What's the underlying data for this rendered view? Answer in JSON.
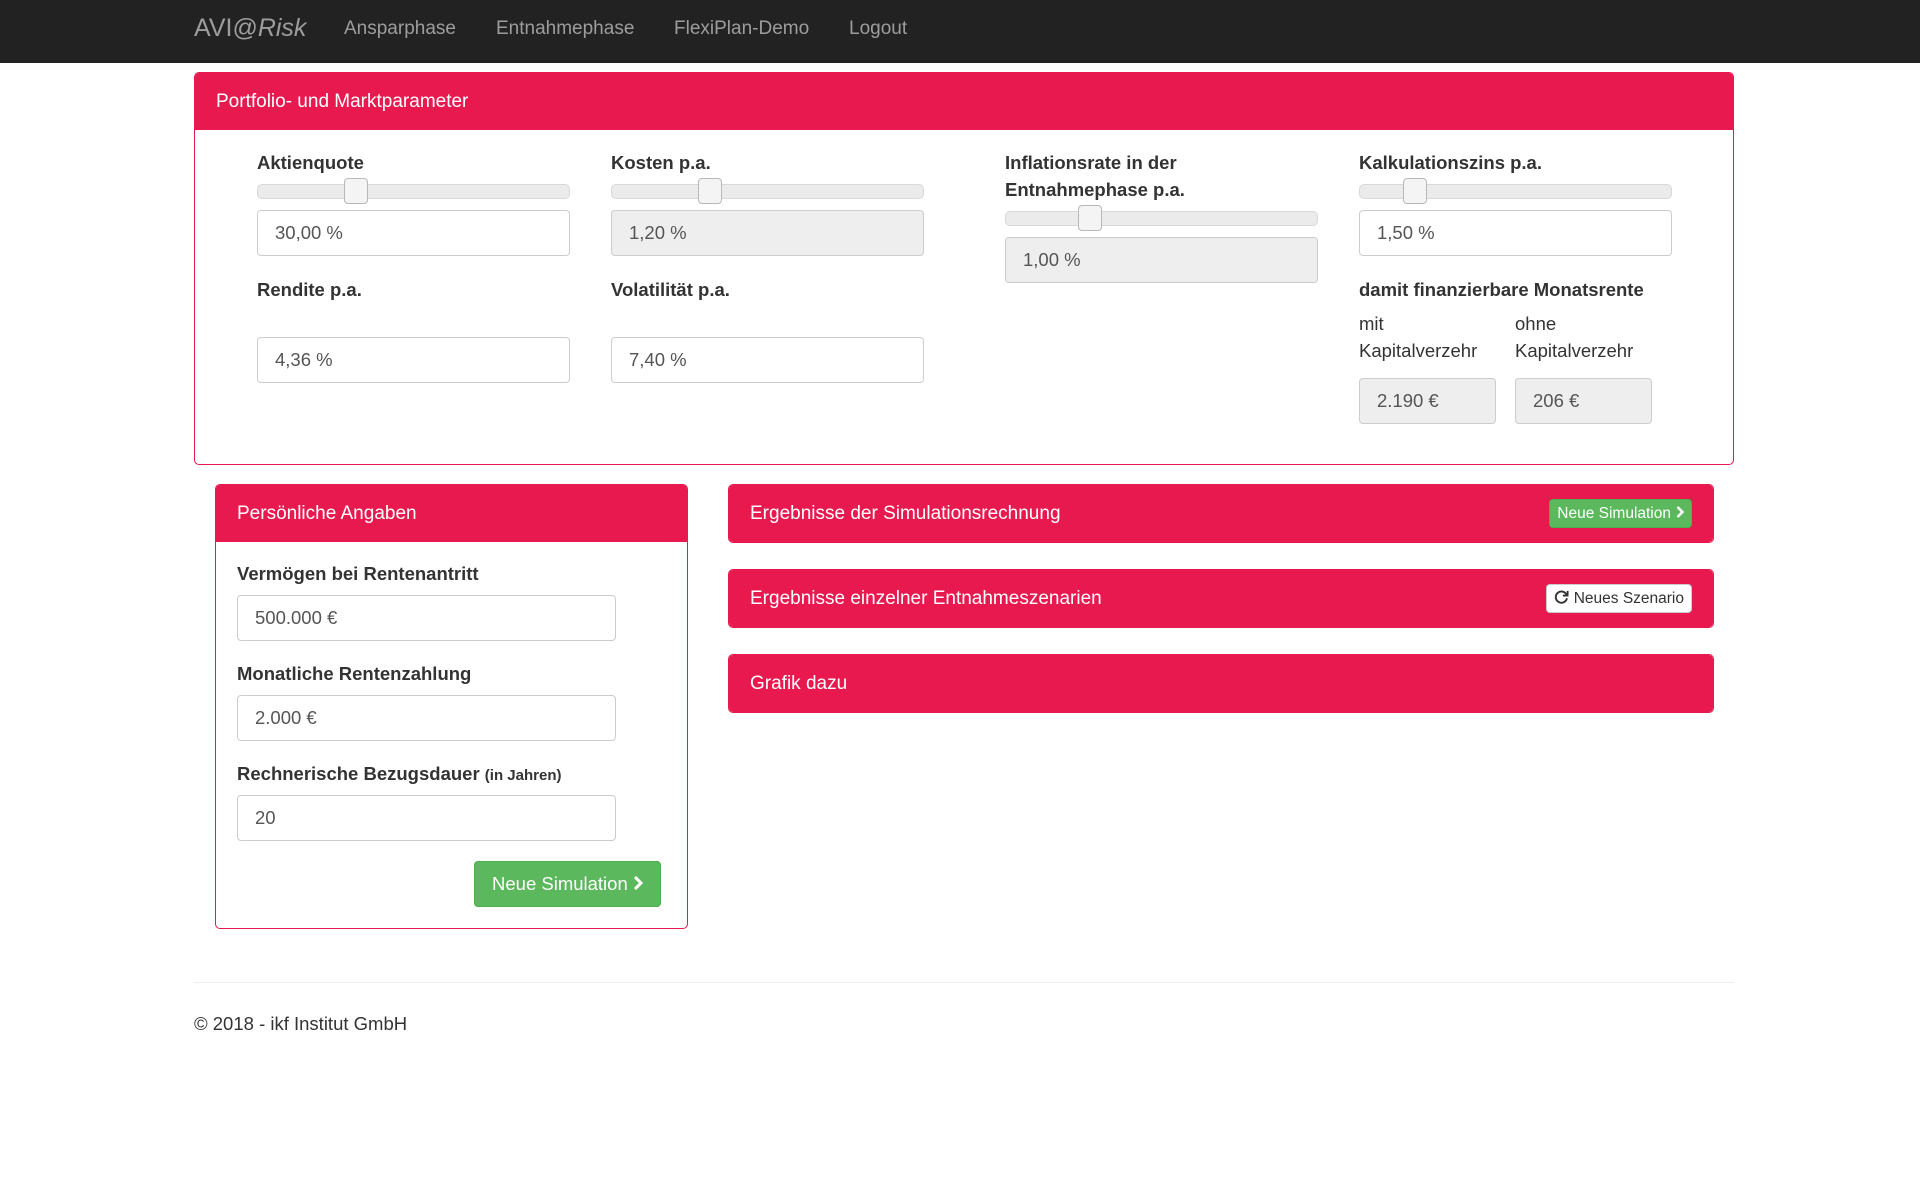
{
  "navbar": {
    "brand_prefix": "AVI@",
    "brand_suffix": "Risk",
    "links": [
      "Ansparphase",
      "Entnahmephase",
      "FlexiPlan-Demo",
      "Logout"
    ]
  },
  "portfolio": {
    "title": "Portfolio- und Marktparameter",
    "aktienquote": {
      "label": "Aktienquote",
      "value": "30,00 %",
      "slider_level": 0.3
    },
    "kosten": {
      "label": "Kosten p.a.",
      "value": "1,20 %",
      "slider_level": 0.3
    },
    "inflation": {
      "label_line1": "Inflationsrate in der",
      "label_line2": "Entnahmephase p.a.",
      "value": "1,00 %",
      "slider_level": 0.25
    },
    "kalkulationszins": {
      "label": "Kalkulationszins p.a.",
      "value": "1,50 %",
      "slider_level": 0.15
    },
    "rendite": {
      "label": "Rendite p.a.",
      "value": "4,36 %"
    },
    "volatilitaet": {
      "label": "Volatilität p.a.",
      "value": "7,40 %"
    },
    "monatsrente": {
      "label": "damit finanzierbare Monatsrente",
      "mit_line1": "mit",
      "mit_line2": "Kapitalverzehr",
      "mit_value": "2.190 €",
      "ohne_line1": "ohne",
      "ohne_line2": "Kapitalverzehr",
      "ohne_value": "206 €"
    }
  },
  "personal": {
    "title": "Persönliche Angaben",
    "vermoegen_label": "Vermögen bei Rentenantritt",
    "vermoegen_value": "500.000 €",
    "rente_label": "Monatliche Rentenzahlung",
    "rente_value": "2.000 €",
    "dauer_label": "Rechnerische Bezugsdauer",
    "dauer_unit": "(in Jahren)",
    "dauer_value": "20",
    "button_label": "Neue Simulation"
  },
  "results": {
    "simulation_title": "Ergebnisse der Simulationsrechnung",
    "simulation_button": "Neue Simulation",
    "scenario_title": "Ergebnisse einzelner Entnahmeszenarien",
    "scenario_button": "Neues Szenario",
    "grafik_title": "Grafik dazu"
  },
  "footer": {
    "text": "© 2018 - ikf Institut GmbH"
  },
  "colors": {
    "accent": "#e8194f",
    "success": "#5cb85c",
    "navbar": "#222222"
  }
}
